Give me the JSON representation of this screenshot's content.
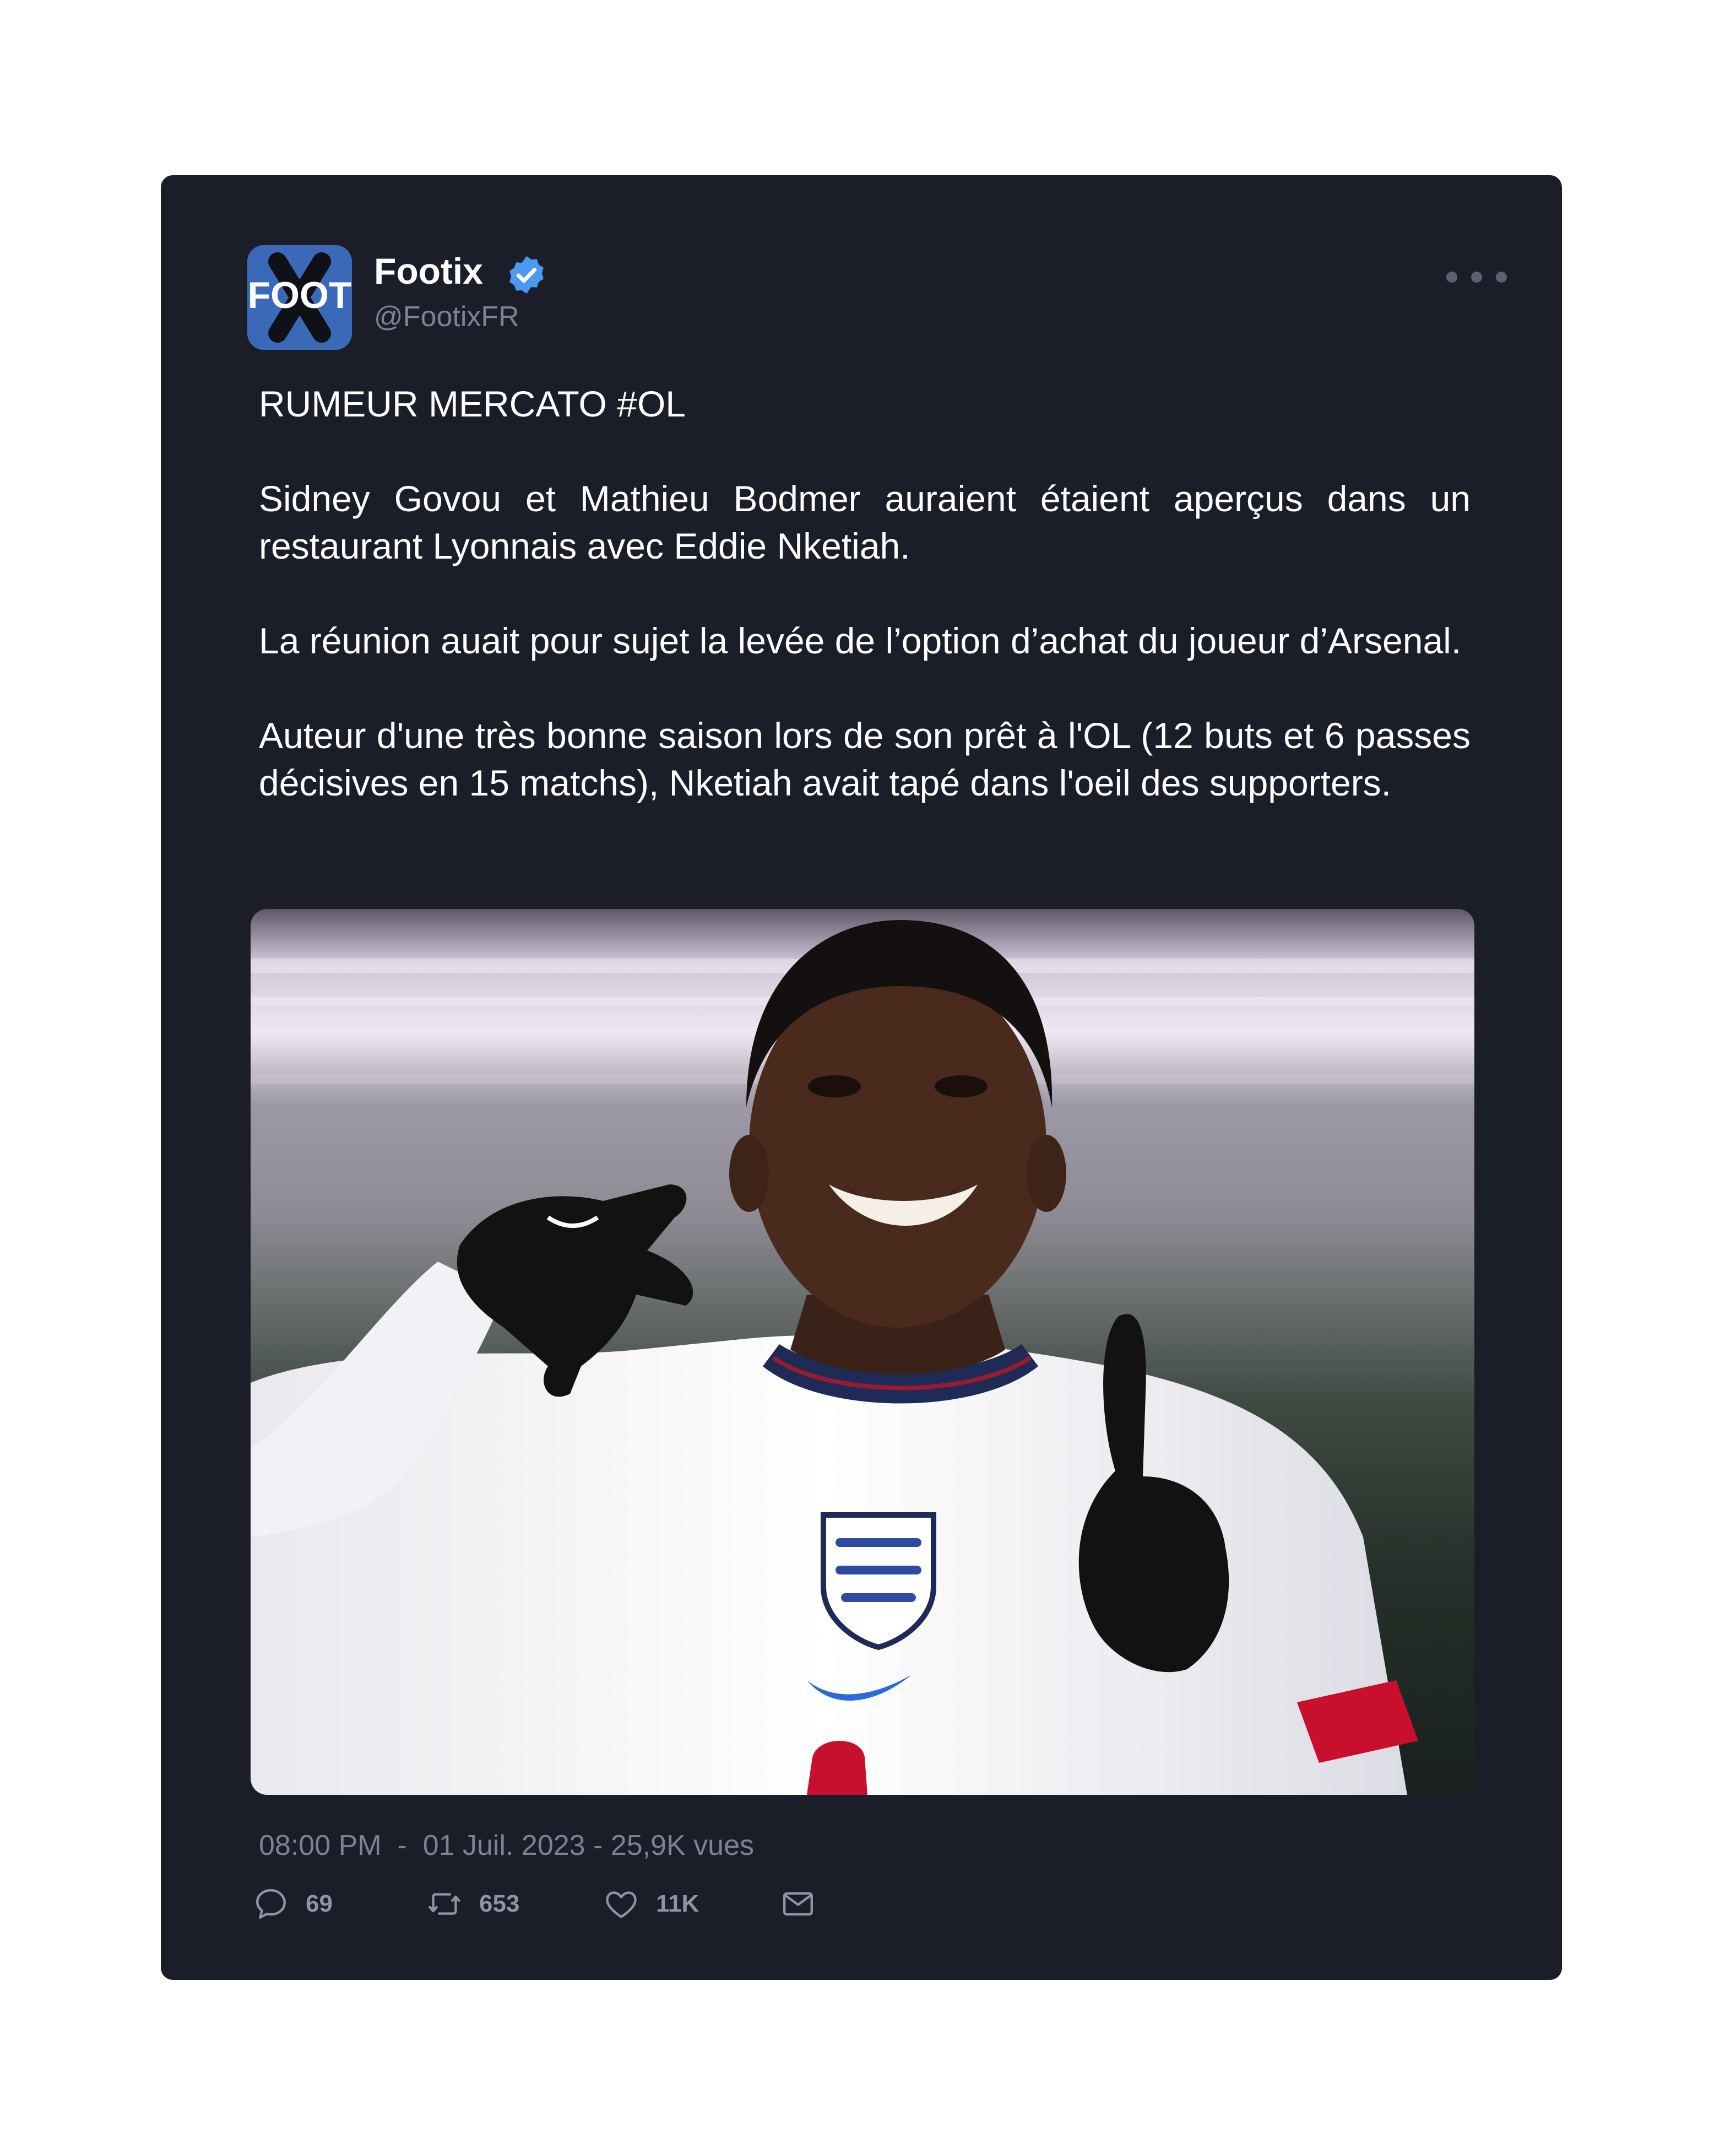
{
  "tweet": {
    "author_name": "Footix",
    "author_handle": "@FootixFR",
    "avatar_text": "FOOT",
    "avatar_color": "#3a6ab7",
    "verified_color": "#4c9aef",
    "paragraphs": [
      "RUMEUR MERCATO #OL",
      "Sidney Govou et Mathieu Bodmer auraient étaient aperçus dans un restaurant Lyonnais avec Eddie Nketiah.",
      "La réunion auait pour sujet la levée de l’option d’achat du joueur d’Arsenal.",
      "Auteur d'une très bonne saison lors de son prêt à l'OL (12 buts et 6 passes décisives en 15 matchs), Nketiah avait tapé dans l'oeil des supporters."
    ],
    "time": "08:00 PM",
    "date": "01 Juil. 2023",
    "views": "25,9K vues",
    "separator": "-",
    "counts": {
      "replies": "69",
      "retweets": "653",
      "likes": "11K"
    }
  },
  "colors": {
    "card_background": "#1b1d29",
    "muted_text": "#7d8193"
  },
  "icons": {
    "reply": "speech-bubble-icon",
    "retweet": "retweet-arrows-icon",
    "like": "heart-icon",
    "share": "envelope-icon",
    "more": "ellipsis-icon",
    "verified": "verified-badge-icon"
  }
}
